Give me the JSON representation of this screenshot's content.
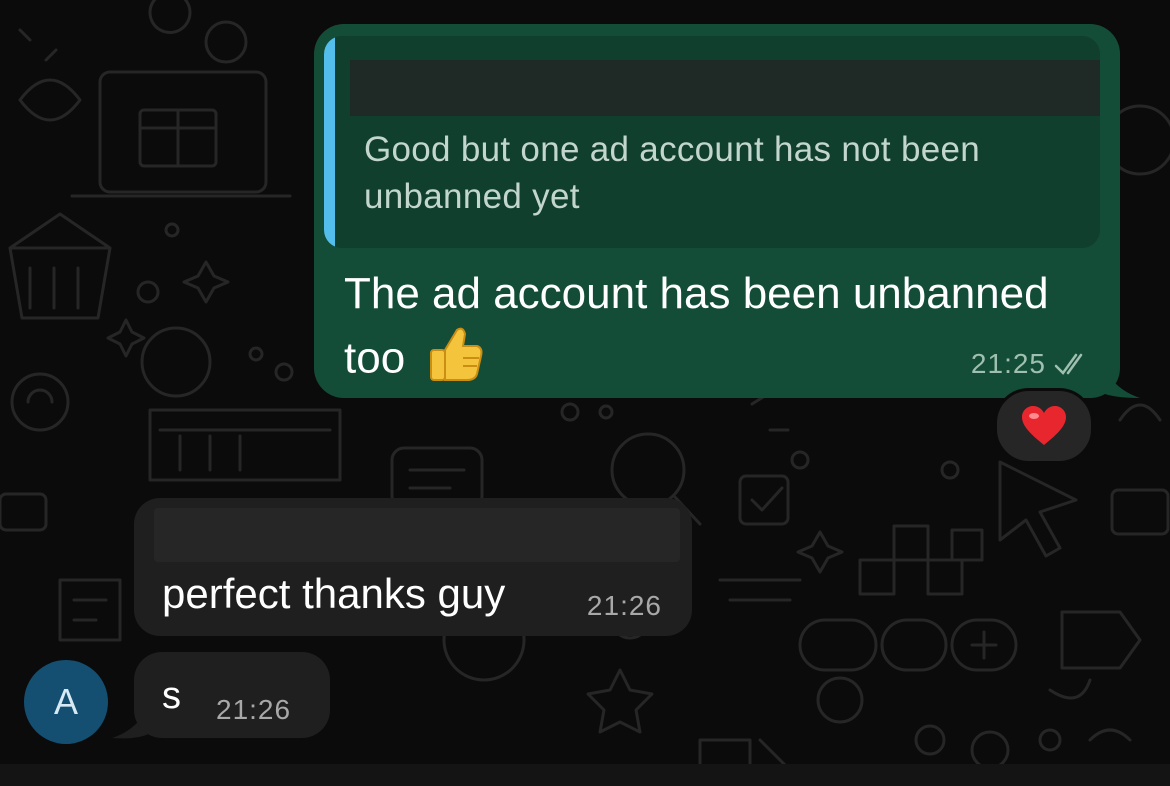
{
  "colors": {
    "background": "#0b0b0b",
    "outgoing_bubble": "#144d37",
    "incoming_bubble": "#1f1f1f",
    "quote_bar": "#53bdeb",
    "avatar_bg": "#144f72"
  },
  "messages": {
    "outgoing": {
      "quoted_text": "Good but one ad account has not been unbanned yet",
      "text": "The ad account has been unbanned too",
      "emoji_icon": "thumbs-up-icon",
      "time": "21:25",
      "status_icon": "double-check-icon",
      "reaction_icon": "red-heart-icon"
    },
    "incoming_1": {
      "text": "perfect thanks guy",
      "time": "21:26"
    },
    "incoming_2": {
      "text": "s",
      "time": "21:26"
    }
  },
  "sender": {
    "avatar_initial": "A"
  }
}
